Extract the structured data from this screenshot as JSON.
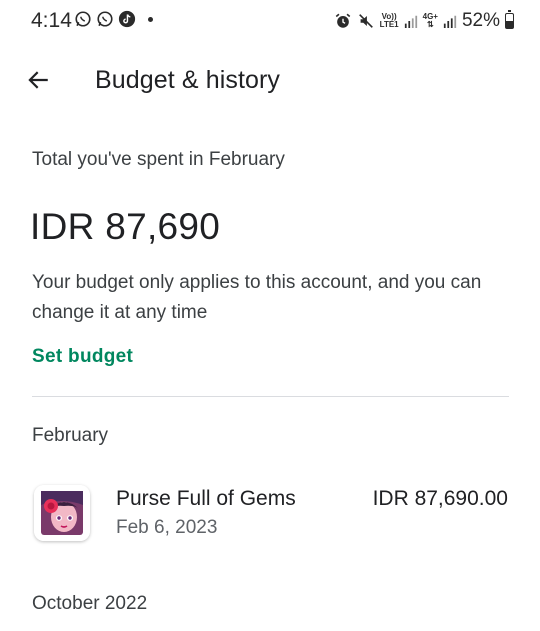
{
  "status_bar": {
    "time": "4:14",
    "left_icons": [
      "whatsapp-icon",
      "whatsapp-business-icon",
      "tiktok-icon",
      "more-notifications-dot"
    ],
    "net1_label": "Vo)) LTE1",
    "net2_label": "4G+",
    "battery_text": "52%",
    "battery_level": 0.52
  },
  "app_bar": {
    "back_icon": "arrow-left-icon",
    "title": "Budget & history"
  },
  "summary": {
    "total_label": "Total you've spent in February",
    "total_amount": "IDR 87,690",
    "budget_note": "Your budget only applies to this account, and you can change it at any time",
    "set_budget_label": "Set budget"
  },
  "months": [
    {
      "name": "February",
      "purchases": [
        {
          "app_name": "Purse Full of Gems",
          "date": "Feb 6, 2023",
          "price": "IDR 87,690.00"
        }
      ]
    },
    {
      "name": "October 2022",
      "purchases": []
    }
  ],
  "colors": {
    "accent": "#01875f",
    "text_primary": "#202124",
    "text_secondary": "#5f6368",
    "divider": "#dadce0"
  }
}
